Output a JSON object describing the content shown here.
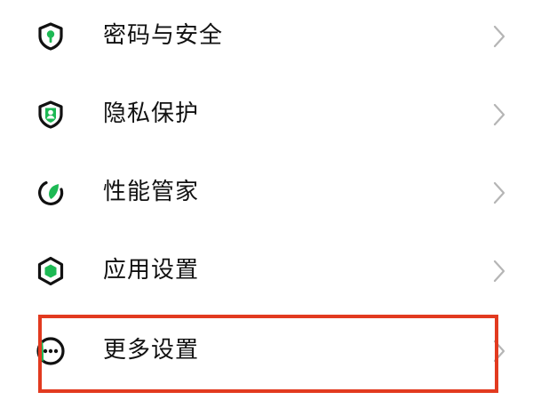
{
  "settings": {
    "items": [
      {
        "label": "密码与安全",
        "icon": "shield-key-icon"
      },
      {
        "label": "隐私保护",
        "icon": "shield-person-icon"
      },
      {
        "label": "性能管家",
        "icon": "performance-leaf-icon"
      },
      {
        "label": "应用设置",
        "icon": "hexagon-app-icon"
      },
      {
        "label": "更多设置",
        "icon": "more-dots-icon"
      }
    ]
  },
  "colors": {
    "accent": "#1db954",
    "icon_outline": "#111111",
    "highlight": "#e23a1f",
    "chevron": "#b5b5b5",
    "text": "#111111"
  }
}
